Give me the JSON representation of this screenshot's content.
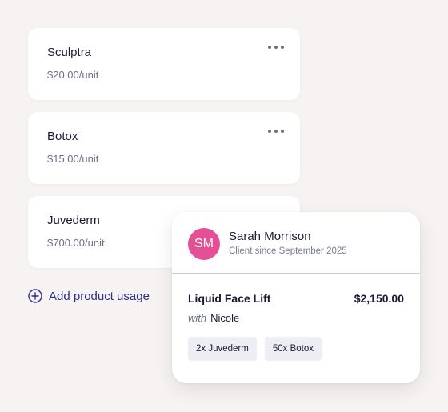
{
  "products": [
    {
      "name": "Sculptra",
      "price": "$20.00/unit"
    },
    {
      "name": "Botox",
      "price": "$15.00/unit"
    },
    {
      "name": "Juvederm",
      "price": "$700.00/unit"
    }
  ],
  "add_usage": {
    "label": "Add product usage",
    "icon": "plus-circle-icon"
  },
  "appointment": {
    "client": {
      "initials": "SM",
      "name": "Sarah Morrison",
      "since": "Client since September 2025",
      "avatar_color": "#e54f95"
    },
    "service": {
      "name": "Liquid Face Lift",
      "price": "$2,150.00",
      "with_label": "with",
      "provider": "Nicole"
    },
    "chips": [
      "2x Juvederm",
      "50x Botox"
    ]
  },
  "colors": {
    "background": "#f6f3f2",
    "accent": "#2f2d8c",
    "avatar": "#e54f95"
  }
}
